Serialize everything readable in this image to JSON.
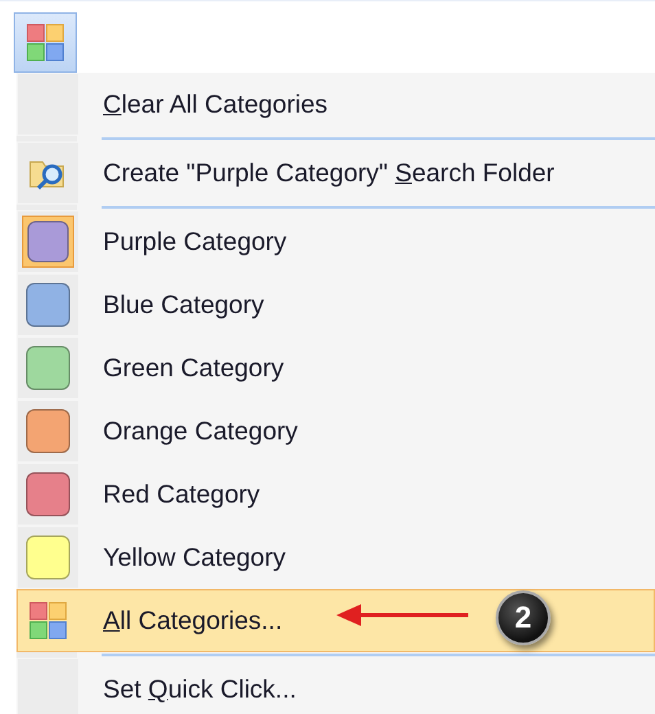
{
  "toolbar_button": {
    "pressed": true
  },
  "menu": {
    "items": [
      {
        "kind": "command",
        "label": [
          {
            "text": "C",
            "underline": true
          },
          {
            "text": "lear All Categories"
          }
        ]
      },
      {
        "kind": "separator"
      },
      {
        "kind": "search",
        "label": [
          {
            "text": "Create \"Purple Category\" "
          },
          {
            "text": "S",
            "underline": true
          },
          {
            "text": "earch Folder"
          }
        ]
      },
      {
        "kind": "separator"
      },
      {
        "kind": "category",
        "label": [
          {
            "text": "Purple Category"
          }
        ],
        "color": "#a99ad8",
        "checked": true
      },
      {
        "kind": "category",
        "label": [
          {
            "text": "Blue Category"
          }
        ],
        "color": "#90b2e4",
        "checked": false
      },
      {
        "kind": "category",
        "label": [
          {
            "text": "Green Category"
          }
        ],
        "color": "#9ed89e",
        "checked": false
      },
      {
        "kind": "category",
        "label": [
          {
            "text": "Orange Category"
          }
        ],
        "color": "#f3a472",
        "checked": false
      },
      {
        "kind": "category",
        "label": [
          {
            "text": "Red Category"
          }
        ],
        "color": "#e6808a",
        "checked": false
      },
      {
        "kind": "category",
        "label": [
          {
            "text": "Yellow Category"
          }
        ],
        "color": "#ffff8e",
        "checked": false
      },
      {
        "kind": "all",
        "label": [
          {
            "text": "A",
            "underline": true
          },
          {
            "text": "ll Categories..."
          }
        ],
        "highlighted": true
      },
      {
        "kind": "separator"
      },
      {
        "kind": "command",
        "label": [
          {
            "text": "Set "
          },
          {
            "text": "Q",
            "underline": true
          },
          {
            "text": "uick Click..."
          }
        ]
      }
    ]
  },
  "annotation": {
    "step": "2"
  }
}
